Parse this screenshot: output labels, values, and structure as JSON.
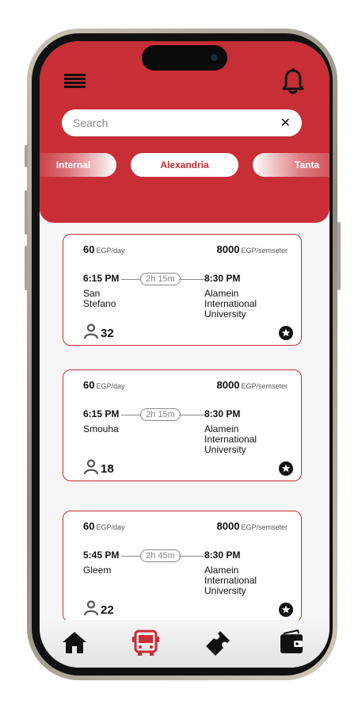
{
  "colors": {
    "accent": "#c82e35",
    "dark": "#111111",
    "background": "#f6f6f6"
  },
  "header": {
    "menu_icon": "hamburger-menu-icon",
    "notification_icon": "bell-icon"
  },
  "search": {
    "placeholder": "Search",
    "value": "",
    "clear_icon": "close-icon"
  },
  "categories": [
    {
      "label": "Internal",
      "active": false
    },
    {
      "label": "Alexandria",
      "active": true
    },
    {
      "label": "Tanta",
      "active": false
    }
  ],
  "trips": [
    {
      "daily_price": "60",
      "daily_unit": "EGP/day",
      "semester_price": "8000",
      "semester_unit": "EGP/semseter",
      "departure_time": "6:15 PM",
      "duration": "2h 15m",
      "arrival_time": "8:30 PM",
      "origin": "San\nStefano",
      "destination": "Alamein\nInternational\nUniversity",
      "seats": "32"
    },
    {
      "daily_price": "60",
      "daily_unit": "EGP/day",
      "semester_price": "8000",
      "semester_unit": "EGP/semseter",
      "departure_time": "6:15 PM",
      "duration": "2h 15m",
      "arrival_time": "8:30 PM",
      "origin": "Smouha",
      "destination": "Alamein\nInternational\nUniversity",
      "seats": "18"
    },
    {
      "daily_price": "60",
      "daily_unit": "EGP/day",
      "semester_price": "8000",
      "semester_unit": "EGP/semseter",
      "departure_time": "5:45 PM",
      "duration": "2h 45m",
      "arrival_time": "8:30 PM",
      "origin": "Gleem",
      "destination": "Alamein\nInternational\nUniversity",
      "seats": "22"
    }
  ],
  "bottom_nav": [
    {
      "icon": "home-icon",
      "active": false
    },
    {
      "icon": "bus-icon",
      "active": true
    },
    {
      "icon": "ticket-icon",
      "active": false
    },
    {
      "icon": "wallet-icon",
      "active": false
    }
  ]
}
